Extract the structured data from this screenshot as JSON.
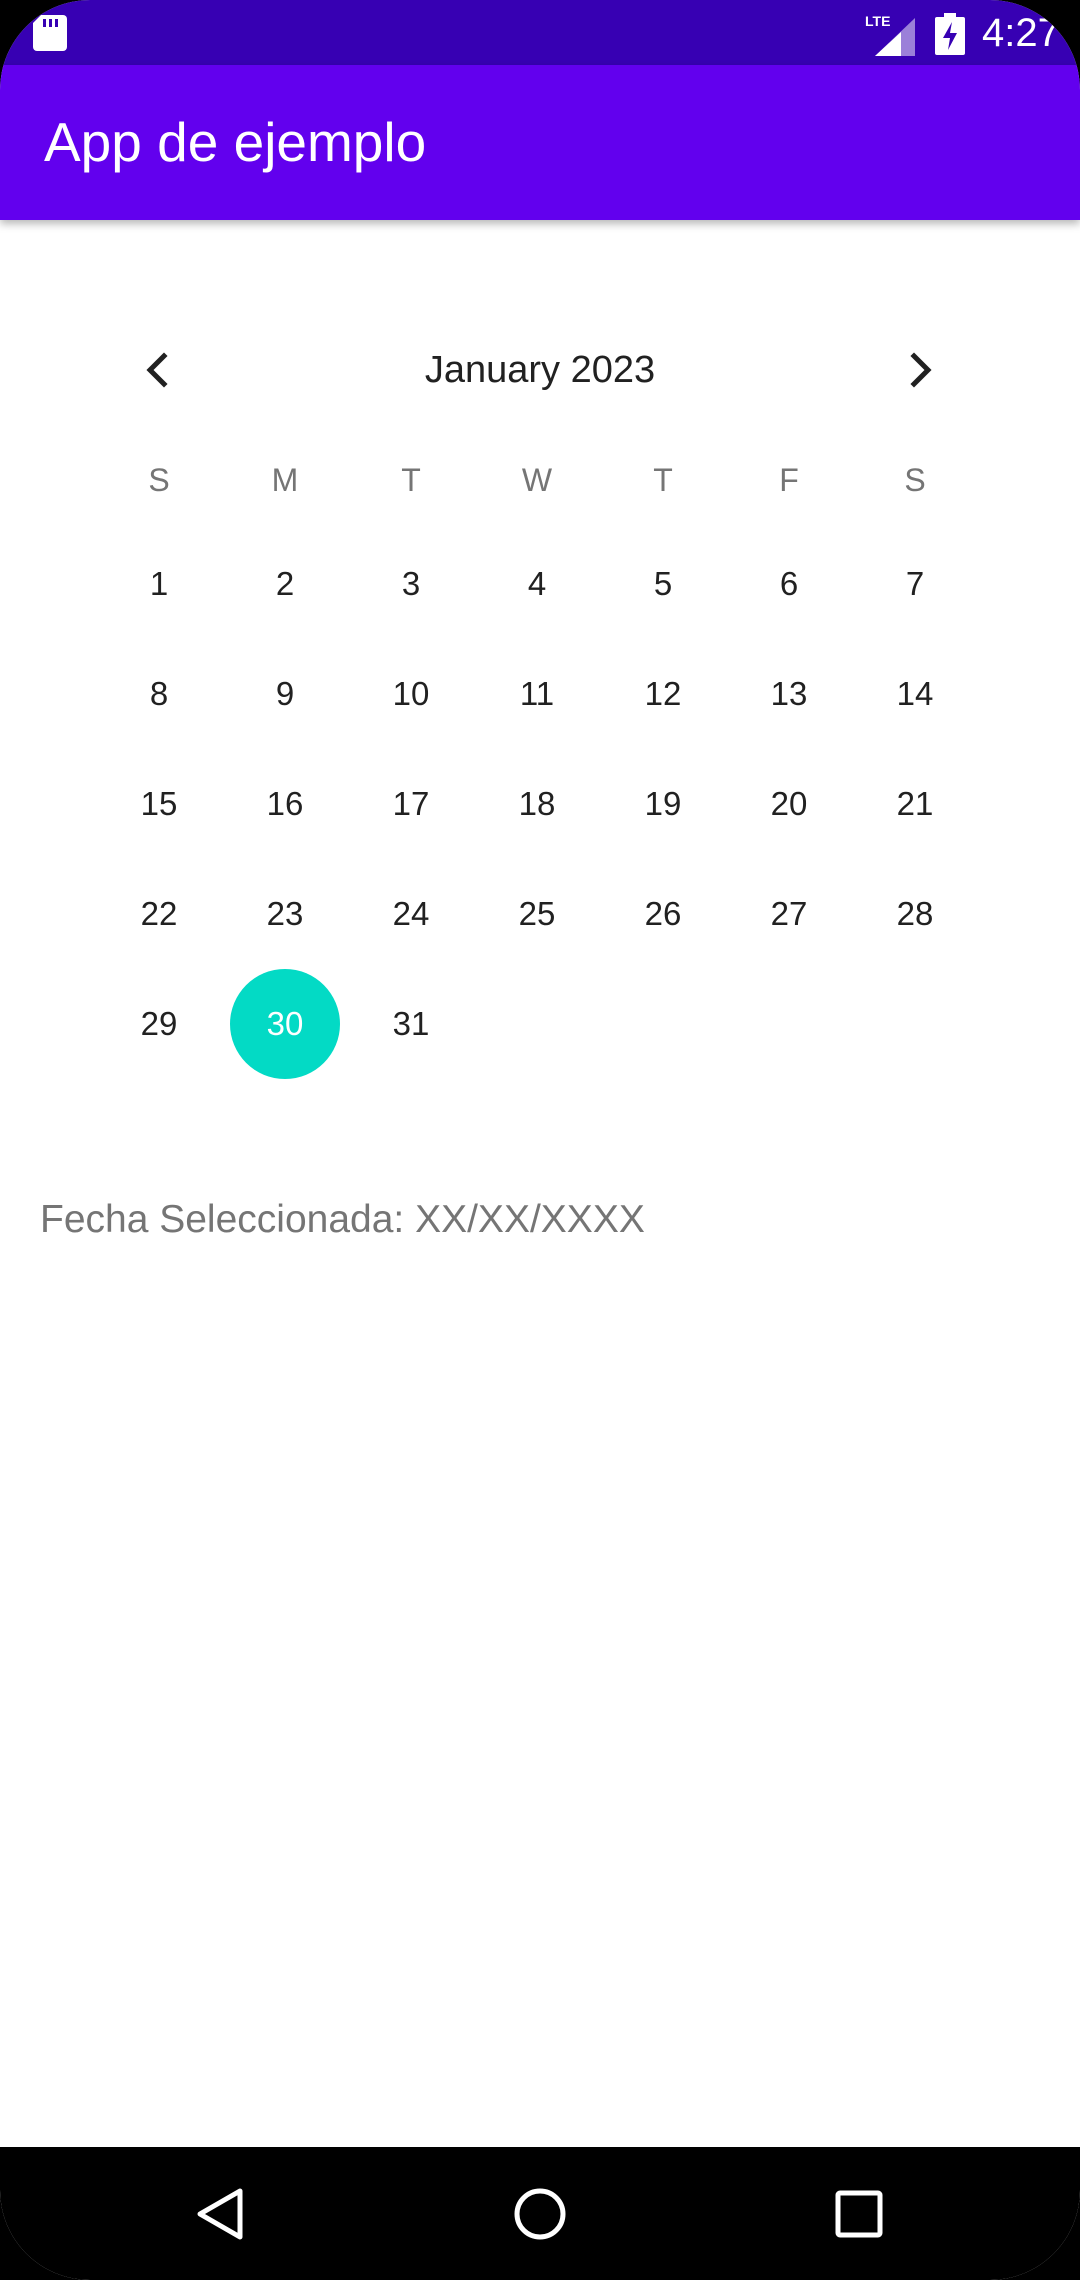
{
  "status_bar": {
    "time": "4:27",
    "network": "LTE",
    "icons": [
      "sd-card-icon",
      "lte-signal-icon",
      "battery-charging-icon"
    ],
    "background": "#3700B3"
  },
  "app_bar": {
    "title": "App de ejemplo",
    "background": "#6200EE"
  },
  "calendar": {
    "month_label": "January 2023",
    "prev_icon": "chevron-left-icon",
    "next_icon": "chevron-right-icon",
    "weekdays": [
      "S",
      "M",
      "T",
      "W",
      "T",
      "F",
      "S"
    ],
    "first_weekday_offset": 0,
    "days_in_month": 31,
    "days": [
      "1",
      "2",
      "3",
      "4",
      "5",
      "6",
      "7",
      "8",
      "9",
      "10",
      "11",
      "12",
      "13",
      "14",
      "15",
      "16",
      "17",
      "18",
      "19",
      "20",
      "21",
      "22",
      "23",
      "24",
      "25",
      "26",
      "27",
      "28",
      "29",
      "30",
      "31"
    ],
    "selected_day": "30",
    "selected_color": "#03DAC5"
  },
  "selected_date": {
    "text": "Fecha Seleccionada: XX/XX/XXXX"
  },
  "navigation_bar": {
    "icons": [
      "back-icon",
      "home-icon",
      "recents-icon"
    ]
  }
}
